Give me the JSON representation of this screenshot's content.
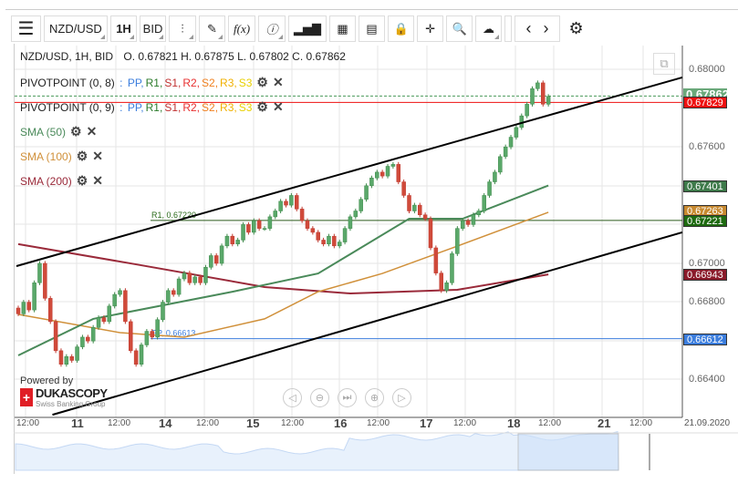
{
  "toolbar": {
    "symbol": "NZD/USD",
    "timeframe": "1H",
    "price_side": "BID"
  },
  "info": {
    "title": "NZD/USD, 1H, BID",
    "ohlc": "O. 0.67821 H. 0.67875 L. 0.67802 C. 0.67862"
  },
  "indicators": [
    {
      "name": "PIVOTPOINT (0, 8)",
      "levels": [
        "PP",
        "R1",
        "S1",
        "R2",
        "S2",
        "R3",
        "S3"
      ]
    },
    {
      "name": "PIVOTPOINT (0, 9)",
      "levels": [
        "PP",
        "R1",
        "S1",
        "R2",
        "S2",
        "R3",
        "S3"
      ]
    },
    {
      "name": "SMA (50)",
      "color": "#4a8a5a"
    },
    {
      "name": "SMA (100)",
      "color": "#d0903a"
    },
    {
      "name": "SMA (200)",
      "color": "#9a2a3a"
    }
  ],
  "level_colors": {
    "PP": "#3b7ddd",
    "R1": "#2a7a2a",
    "S1": "#c03030",
    "R2": "#e83030",
    "S2": "#f08020",
    "R3": "#f0b000",
    "S3": "#e8d000"
  },
  "y_axis": {
    "ticks": [
      "0.68000",
      "0.67600",
      "0.67000",
      "0.66800",
      "0.66400"
    ]
  },
  "price_labels": [
    {
      "value": "0.67862",
      "color": "#6aa87a"
    },
    {
      "value": "0.67829",
      "color": "#ee1111"
    },
    {
      "value": "0.67401",
      "color": "#3e7a4a"
    },
    {
      "value": "0.67263",
      "color": "#c88a30"
    },
    {
      "value": "0.67221",
      "color": "#1e6a10"
    },
    {
      "value": "0.66943",
      "color": "#8a1a2a"
    },
    {
      "value": "0.66612",
      "color": "#3b7ddd"
    }
  ],
  "chart_labels": {
    "r1": "R1, 0.67220",
    "pp": "PP, 0.66613"
  },
  "x_axis": [
    "12:00",
    "11",
    "12:00",
    "14",
    "12:00",
    "15",
    "12:00",
    "16",
    "12:00",
    "17",
    "12:00",
    "18",
    "12:00",
    "21",
    "12:00",
    "21.09.2020"
  ],
  "branding": {
    "powered": "Powered by",
    "name": "DUKASCOPY",
    "sub": "Swiss Banking Group"
  },
  "chart_data": {
    "type": "candlestick",
    "symbol": "NZD/USD",
    "interval": "1H",
    "ylim": [
      0.6628,
      0.6818
    ],
    "closes": [
      0.6674,
      0.668,
      0.6676,
      0.669,
      0.67,
      0.6682,
      0.667,
      0.6655,
      0.6648,
      0.6652,
      0.665,
      0.6657,
      0.6662,
      0.666,
      0.6667,
      0.6672,
      0.667,
      0.6678,
      0.6684,
      0.6686,
      0.667,
      0.6655,
      0.6648,
      0.6658,
      0.6665,
      0.6662,
      0.6671,
      0.668,
      0.6686,
      0.6684,
      0.6692,
      0.6695,
      0.669,
      0.6693,
      0.669,
      0.6698,
      0.6704,
      0.67,
      0.6709,
      0.6714,
      0.671,
      0.6712,
      0.672,
      0.6716,
      0.6722,
      0.6718,
      0.6718,
      0.6724,
      0.6727,
      0.6732,
      0.673,
      0.6735,
      0.6728,
      0.6722,
      0.6718,
      0.6716,
      0.6712,
      0.671,
      0.6714,
      0.6709,
      0.6711,
      0.6718,
      0.6724,
      0.6727,
      0.6733,
      0.674,
      0.6744,
      0.6747,
      0.6745,
      0.675,
      0.6751,
      0.6742,
      0.6735,
      0.6727,
      0.673,
      0.6725,
      0.6723,
      0.6708,
      0.6695,
      0.6686,
      0.669,
      0.6705,
      0.6718,
      0.6722,
      0.672,
      0.6725,
      0.6727,
      0.6735,
      0.6742,
      0.6747,
      0.6755,
      0.676,
      0.6765,
      0.677,
      0.6776,
      0.6782,
      0.679,
      0.6793,
      0.6782,
      0.6786
    ],
    "sma50": [
      [
        0,
        0.66526
      ],
      [
        14,
        0.66714
      ],
      [
        40,
        0.66854
      ],
      [
        56,
        0.66948
      ],
      [
        73,
        0.6723
      ],
      [
        83,
        0.6723
      ],
      [
        99,
        0.67401
      ]
    ],
    "sma100": [
      [
        0,
        0.66737
      ],
      [
        19,
        0.66643
      ],
      [
        31,
        0.6662
      ],
      [
        46,
        0.66714
      ],
      [
        56,
        0.66854
      ],
      [
        68,
        0.66948
      ],
      [
        82,
        0.67089
      ],
      [
        99,
        0.67263
      ]
    ],
    "sma200": [
      [
        0,
        0.67099
      ],
      [
        22,
        0.66995
      ],
      [
        46,
        0.66878
      ],
      [
        62,
        0.66845
      ],
      [
        82,
        0.66864
      ],
      [
        99,
        0.66943
      ]
    ],
    "channel_upper": [
      [
        0,
        0.66986
      ],
      [
        124,
        0.67958
      ]
    ],
    "channel_lower": [
      [
        4,
        0.6622
      ],
      [
        124,
        0.6716
      ]
    ],
    "horizontal_levels": {
      "last": 0.67862,
      "pivot_red": 0.67829,
      "r1": 0.67221,
      "pp": 0.66612
    }
  }
}
